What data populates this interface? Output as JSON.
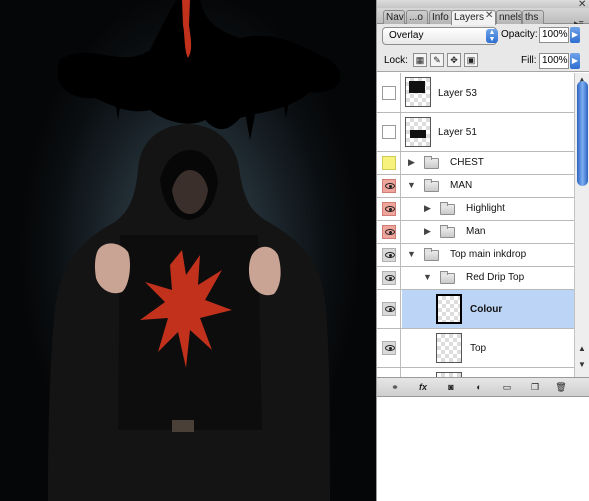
{
  "panel": {
    "tabs": [
      {
        "label": "Nav",
        "active": false
      },
      {
        "label": "...o",
        "active": false
      },
      {
        "label": "Info",
        "active": false
      },
      {
        "label": "Layers",
        "active": true
      },
      {
        "label": "nnels",
        "active": false
      },
      {
        "label": "ths",
        "active": false
      }
    ],
    "tab_close": "✕",
    "window_close": "✕",
    "menu": "▸≡",
    "blend_mode": "Overlay",
    "opacity_label": "Opacity:",
    "opacity_value": "100%",
    "lock_label": "Lock:",
    "fill_label": "Fill:",
    "fill_value": "100%"
  },
  "layers": [
    {
      "name": "Layer 53",
      "type": "layer",
      "visibility": "empty",
      "thumb": "black-top"
    },
    {
      "name": "Layer 51",
      "type": "layer",
      "visibility": "empty",
      "thumb": "black-mid"
    },
    {
      "name": "CHEST",
      "type": "group",
      "visibility": "yellow",
      "expanded": false
    },
    {
      "name": "MAN",
      "type": "group",
      "visibility": "red",
      "expanded": true
    },
    {
      "name": "Highlight",
      "type": "group",
      "visibility": "red",
      "expanded": false
    },
    {
      "name": "Man",
      "type": "group",
      "visibility": "red",
      "expanded": false
    },
    {
      "name": "Top main inkdrop",
      "type": "group",
      "visibility": "gray",
      "expanded": true
    },
    {
      "name": "Red Drip Top",
      "type": "group",
      "visibility": "gray",
      "expanded": true
    },
    {
      "name": "Colour",
      "type": "layer",
      "visibility": "gray",
      "selected": true
    },
    {
      "name": "Top",
      "type": "layer",
      "visibility": "gray"
    }
  ],
  "colors": {
    "selection": "#bcd4f5",
    "accent_blue": "#2f6fd0",
    "visibility_red": "#f0a59c",
    "visibility_yellow": "#f7f27d",
    "ink_red": "#c2311c"
  },
  "icons": {
    "link": "link-icon",
    "fx": "fx-icon",
    "mask": "mask-icon",
    "adjustment": "adjustment-icon",
    "new_group": "folder-icon",
    "new_layer": "new-layer-icon",
    "delete": "trash-icon"
  }
}
